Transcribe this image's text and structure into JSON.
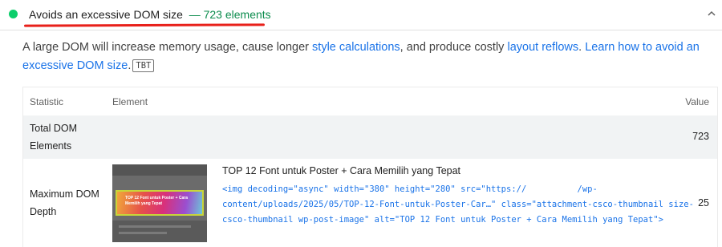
{
  "audit": {
    "title": "Avoids an excessive DOM size",
    "display_value": "— 723 elements",
    "status": "pass",
    "status_color": "#0cce6b",
    "collapse_icon": "chevron-up-icon"
  },
  "description": {
    "text_1": "A large DOM will increase memory usage, cause longer ",
    "link_1": "style calculations",
    "text_2": ", and produce costly ",
    "link_2": "layout reflows",
    "text_3": ". ",
    "link_3": "Learn how to avoid an excessive DOM size",
    "text_4": ".",
    "badge": "TBT"
  },
  "table": {
    "headers": {
      "statistic": "Statistic",
      "element": "Element",
      "value": "Value"
    },
    "rows": [
      {
        "statistic": "Total DOM Elements",
        "value": "723"
      },
      {
        "statistic": "Maximum DOM Depth",
        "value": "25",
        "node_label": "TOP 12 Font untuk Poster + Cara Memilih yang Tepat",
        "snippet": "<img decoding=\"async\" width=\"380\" height=\"280\" src=\"https://          /wp-content/uploads/2025/05/TOP-12-Font-untuk-Poster-Car…\" class=\"attachment-csco-thumbnail size-csco-thumbnail wp-post-image\" alt=\"TOP 12 Font untuk Poster + Cara Memilih yang Tepat\">",
        "thumbnail_text": "TOP 12 Font untuk Poster + Cara Memilih yang Tepat"
      }
    ]
  },
  "colors": {
    "link": "#1a73e8",
    "pass": "#0cce6b",
    "display_value": "#0c8c4d",
    "annotation_underline": "#e8201a"
  }
}
